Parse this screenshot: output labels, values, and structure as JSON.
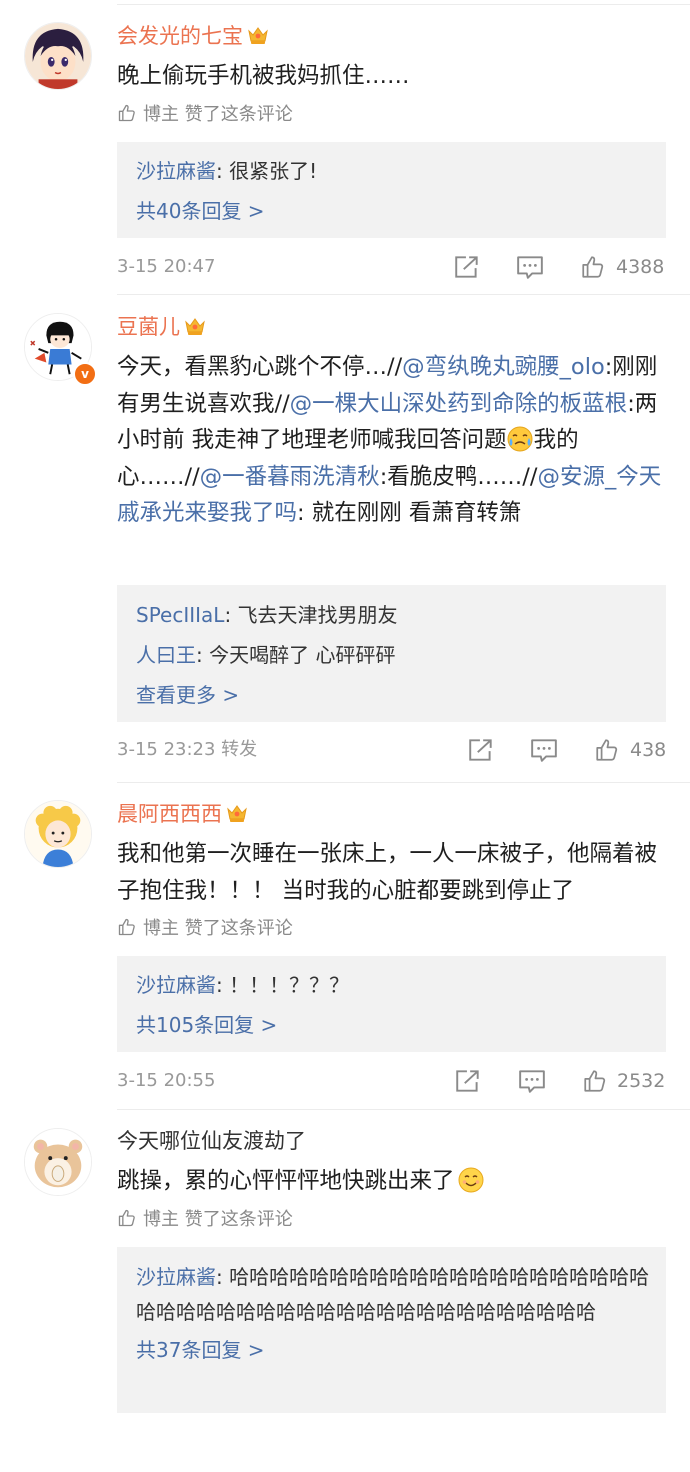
{
  "comments": [
    {
      "username": "会发光的七宝",
      "text": "晚上偷玩手机被我妈抓住……",
      "liked_note": "博主  赞了这条评论",
      "replies": [
        {
          "author": "沙拉麻酱",
          "text": ": 很紧张了!"
        }
      ],
      "more": "共40条回复 >",
      "time": "3-15 20:47",
      "likes": "4388"
    },
    {
      "username": "豆菌儿",
      "text_parts": [
        "今天，看黑豹心跳个不停…//",
        "@弯纨晚丸豌腰_olo",
        ":刚刚有男生说喜欢我//",
        "@一棵大山深处药到命除的板蓝根",
        ":两小时前 我走神了地理老师喊我回答问题",
        "我的心……//",
        "@一番暮雨洗清秋",
        ":看脆皮鸭……//",
        "@安源_今天戚承光来娶我了吗",
        ": 就在刚刚  看萧育转箫"
      ],
      "replies": [
        {
          "author": "SPecIIIaL",
          "text": ": 飞去天津找男朋友"
        },
        {
          "author": "人曰王",
          "text": ": 今天喝醉了 心砰砰砰"
        }
      ],
      "more": "查看更多 >",
      "time": "3-15 23:23 转发",
      "likes": "438"
    },
    {
      "username": "晨阿西西西",
      "text": "我和他第一次睡在一张床上，一人一床被子，他隔着被子抱住我！！！ 当时我的心脏都要跳到停止了",
      "liked_note": "博主  赞了这条评论",
      "replies": [
        {
          "author": "沙拉麻酱",
          "text": ": ！！！？？？"
        }
      ],
      "more": "共105条回复 >",
      "time": "3-15 20:55",
      "likes": "2532"
    },
    {
      "username": "今天哪位仙友渡劫了",
      "text": "跳操，累的心怦怦怦地快跳出来了",
      "liked_note": "博主  赞了这条评论",
      "replies": [
        {
          "author": "沙拉麻酱",
          "text": ": 哈哈哈哈哈哈哈哈哈哈哈哈哈哈哈哈哈哈哈哈哈哈哈哈哈哈哈哈哈哈哈哈哈哈哈哈哈哈哈哈哈哈哈哈"
        }
      ],
      "more": "共37条回复 >",
      "time": "",
      "likes": ""
    }
  ],
  "icons": {
    "crown": "crown-icon",
    "thumb": "thumb-up-icon",
    "share": "share-icon",
    "comment": "comment-icon",
    "verified": "verified-badge-icon"
  },
  "colors": {
    "username": "#eb7350",
    "link": "#4a6fa8",
    "reply_bg": "#f2f2f2",
    "meta": "#999999"
  },
  "badges": {
    "verified": "v"
  }
}
